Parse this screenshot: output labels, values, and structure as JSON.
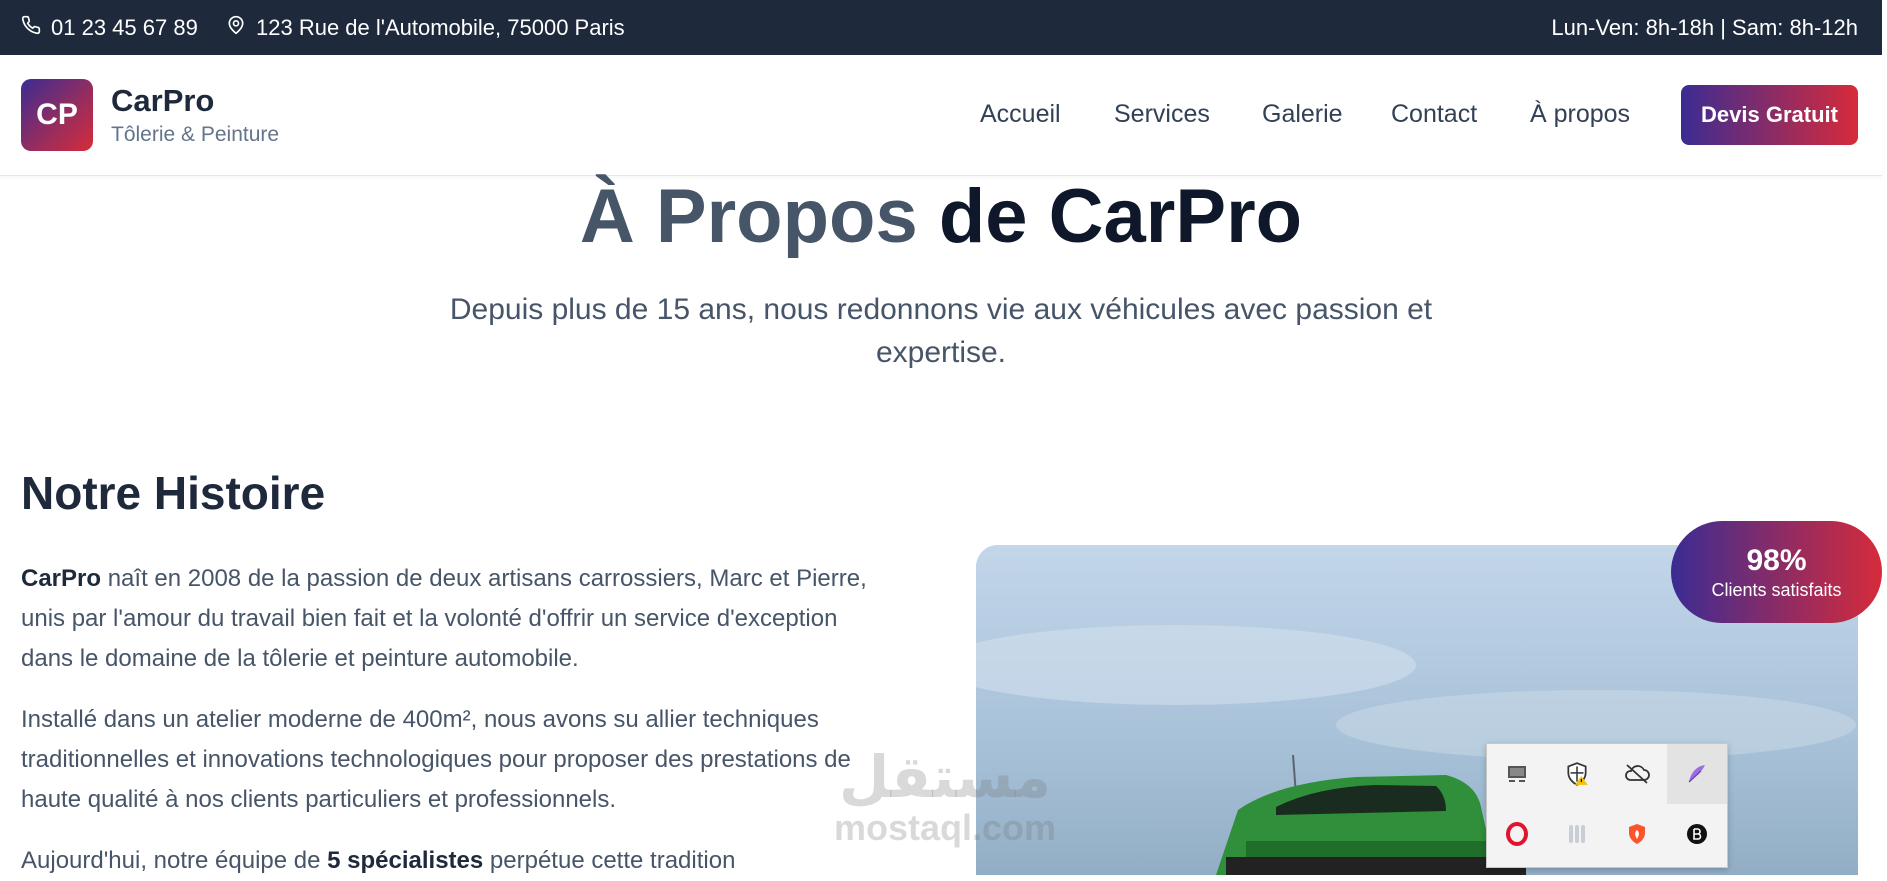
{
  "topbar": {
    "phone": "01 23 45 67 89",
    "address": "123 Rue de l'Automobile, 75000 Paris",
    "hours": "Lun-Ven: 8h-18h | Sam: 8h-12h"
  },
  "brand": {
    "logo_text": "CP",
    "name": "CarPro",
    "tagline": "Tôlerie & Peinture"
  },
  "nav": {
    "items": [
      {
        "label": "Accueil"
      },
      {
        "label": "Services"
      },
      {
        "label": "Galerie"
      },
      {
        "label": "Contact"
      },
      {
        "label": "À propos"
      }
    ],
    "cta": "Devis Gratuit"
  },
  "hero": {
    "title_part1": "À Propos",
    "title_part2": "de CarPro",
    "subtitle": "Depuis plus de 15 ans, nous redonnons vie aux véhicules avec passion et expertise."
  },
  "history": {
    "heading": "Notre Histoire",
    "p1_strong": "CarPro",
    "p1_text": " naît en 2008 de la passion de deux artisans carrossiers, Marc et Pierre, unis par l'amour du travail bien fait et la volonté d'offrir un service d'exception dans le domaine de la tôlerie et peinture automobile.",
    "p2_text": "Installé dans un atelier moderne de 400m², nous avons su allier techniques traditionnelles et innovations technologiques pour proposer des prestations de haute qualité à nos clients particuliers et professionnels.",
    "p3_pre": "Aujourd'hui, notre équipe de ",
    "p3_strong": "5 spécialistes",
    "p3_post": " perpétue cette tradition"
  },
  "stat_badge": {
    "value": "98%",
    "label": "Clients satisfaits"
  },
  "system_tray": {
    "icons": [
      "monitor-icon",
      "shield-warning-icon",
      "cloud-off-icon",
      "feather-icon",
      "opera-icon",
      "audio-bars-icon",
      "brave-icon",
      "b-circle-icon"
    ]
  },
  "watermark": {
    "arabic": "مستقل",
    "latin": "mostaql.com"
  },
  "colors": {
    "topbar_bg": "#1e293b",
    "gradient_start": "#3b2c93",
    "gradient_end": "#d62b3a",
    "text_dark": "#1e293b",
    "text_muted": "#475569"
  }
}
